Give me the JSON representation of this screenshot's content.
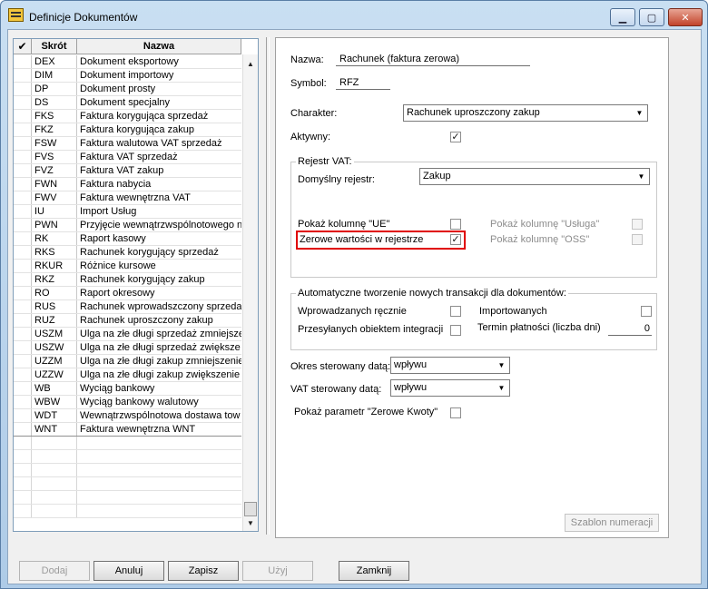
{
  "window": {
    "title": "Definicje Dokumentów",
    "minimize": "▁",
    "maximize": "▢",
    "close": "✕"
  },
  "list": {
    "headers": {
      "check": "✔",
      "skrot": "Skrót",
      "nazwa": "Nazwa"
    },
    "rows": [
      {
        "skrot": "DEX",
        "nazwa": "Dokument eksportowy"
      },
      {
        "skrot": "DIM",
        "nazwa": "Dokument importowy"
      },
      {
        "skrot": "DP",
        "nazwa": "Dokument prosty"
      },
      {
        "skrot": "DS",
        "nazwa": "Dokument specjalny"
      },
      {
        "skrot": "FKS",
        "nazwa": "Faktura korygująca sprzedaż"
      },
      {
        "skrot": "FKZ",
        "nazwa": "Faktura korygująca zakup"
      },
      {
        "skrot": "FSW",
        "nazwa": "Faktura walutowa VAT sprzedaż"
      },
      {
        "skrot": "FVS",
        "nazwa": "Faktura VAT sprzedaż"
      },
      {
        "skrot": "FVZ",
        "nazwa": "Faktura VAT zakup"
      },
      {
        "skrot": "FWN",
        "nazwa": "Faktura nabycia"
      },
      {
        "skrot": "FWV",
        "nazwa": "Faktura wewnętrzna VAT"
      },
      {
        "skrot": "IU",
        "nazwa": "Import Usług"
      },
      {
        "skrot": "PWN",
        "nazwa": "Przyjęcie wewnątrzwspólnotowego n"
      },
      {
        "skrot": "RK",
        "nazwa": "Raport kasowy"
      },
      {
        "skrot": "RKS",
        "nazwa": "Rachunek korygujący sprzedaż"
      },
      {
        "skrot": "RKUR",
        "nazwa": "Różnice kursowe"
      },
      {
        "skrot": "RKZ",
        "nazwa": "Rachunek korygujący zakup"
      },
      {
        "skrot": "RO",
        "nazwa": "Raport okresowy"
      },
      {
        "skrot": "RUS",
        "nazwa": "Rachunek wprowadszczony sprzedaż"
      },
      {
        "skrot": "RUZ",
        "nazwa": "Rachunek uproszczony zakup"
      },
      {
        "skrot": "USZM",
        "nazwa": "Ulga na złe długi sprzedaż zmniejsze"
      },
      {
        "skrot": "USZW",
        "nazwa": "Ulga na złe długi sprzedaż zwiększe"
      },
      {
        "skrot": "UZZM",
        "nazwa": "Ulga na złe długi zakup zmniejszenie"
      },
      {
        "skrot": "UZZW",
        "nazwa": "Ulga na złe długi zakup zwiększenie"
      },
      {
        "skrot": "WB",
        "nazwa": "Wyciąg bankowy"
      },
      {
        "skrot": "WBW",
        "nazwa": "Wyciąg bankowy walutowy"
      },
      {
        "skrot": "WDT",
        "nazwa": "Wewnątrzwspólnotowa dostawa tow"
      },
      {
        "skrot": "WNT",
        "nazwa": "Faktura wewnętrzna WNT"
      }
    ]
  },
  "form": {
    "nazwa_label": "Nazwa:",
    "nazwa_value": "Rachunek (faktura zerowa)",
    "symbol_label": "Symbol:",
    "symbol_value": "RFZ",
    "charakter_label": "Charakter:",
    "charakter_value": "Rachunek uproszczony zakup",
    "aktywny_label": "Aktywny:",
    "aktywny_checked": "✓",
    "rejestr_group": {
      "title": "Rejestr VAT:",
      "domyslny_label": "Domyślny rejestr:",
      "domyslny_value": "Zakup",
      "pokaz_ue_label": "Pokaż kolumnę \"UE\"",
      "pokaz_usluga_label": "Pokaż kolumnę \"Usługa\"",
      "zerowe_label": "Zerowe wartości w rejestrze",
      "zerowe_checked": "✓",
      "pokaz_oss_label": "Pokaż kolumnę \"OSS\""
    },
    "auto_group": {
      "title": "Automatyczne tworzenie nowych transakcji dla dokumentów:",
      "wprowadzanych_label": "Wprowadzanych ręcznie",
      "importowanych_label": "Importowanych",
      "przesylanych_label": "Przesyłanych obiektem integracji",
      "termin_label": "Termin płatności (liczba dni)",
      "termin_value": "0"
    },
    "okres_label": "Okres sterowany datą:",
    "okres_value": "wpływu",
    "vat_label": "VAT sterowany datą:",
    "vat_value": "wpływu",
    "pokaz_zerowe_label": "Pokaż parametr \"Zerowe Kwoty\"",
    "szablon_button": "Szablon numeracji"
  },
  "buttons": {
    "dodaj": "Dodaj",
    "anuluj": "Anuluj",
    "zapisz": "Zapisz",
    "uzyj": "Użyj",
    "zamknij": "Zamknij"
  }
}
